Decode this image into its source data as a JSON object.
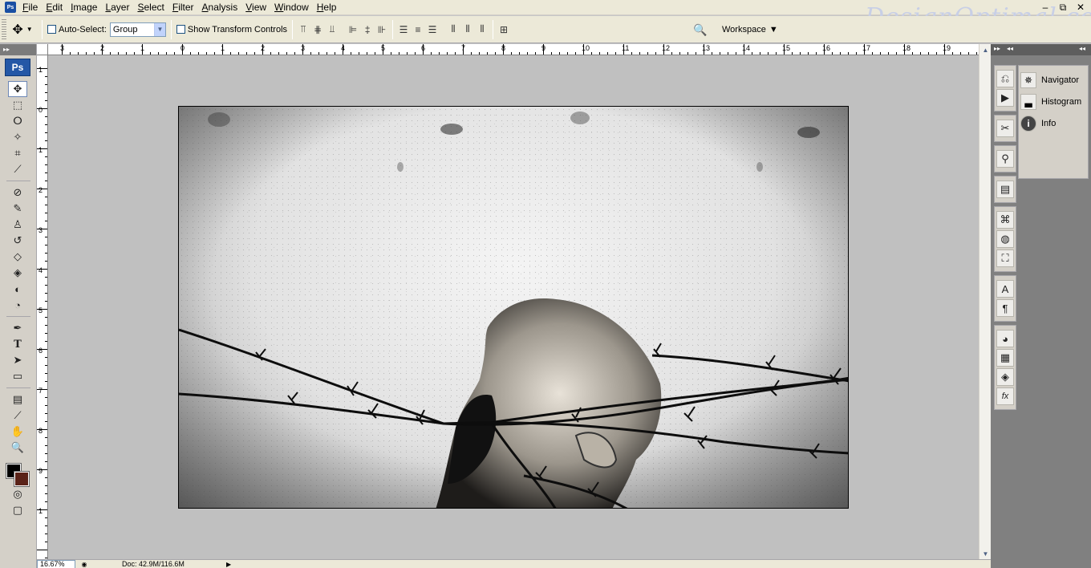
{
  "menubar": {
    "app_icon": "Ps",
    "items": [
      "File",
      "Edit",
      "Image",
      "Layer",
      "Select",
      "Filter",
      "Analysis",
      "View",
      "Window",
      "Help"
    ],
    "watermark": "DesignOptimal.com"
  },
  "window_controls": {
    "minimize": "–",
    "restore": "⧉",
    "close": "✕"
  },
  "options": {
    "auto_select_label": "Auto-Select:",
    "auto_select_value": "Group",
    "show_transform_label": "Show Transform Controls",
    "workspace_label": "Workspace"
  },
  "toolbox": {
    "logo": "Ps"
  },
  "ruler": {
    "top": [
      "3",
      "2",
      "1",
      "0",
      "1",
      "2",
      "3",
      "4",
      "5",
      "6",
      "7",
      "8",
      "9",
      "10",
      "11",
      "12",
      "13",
      "14",
      "15",
      "16",
      "17",
      "18",
      "19"
    ],
    "left": [
      "1",
      "0",
      "1",
      "2",
      "3",
      "4",
      "5",
      "6",
      "7",
      "8",
      "9",
      "1"
    ]
  },
  "status": {
    "zoom": "16.67%",
    "doc_info": "Doc: 42.9M/116.6M"
  },
  "dock": {
    "panels": [
      {
        "label": "Navigator",
        "icon": "navigator-icon"
      },
      {
        "label": "Histogram",
        "icon": "histogram-icon"
      },
      {
        "label": "Info",
        "icon": "info-icon"
      }
    ]
  }
}
